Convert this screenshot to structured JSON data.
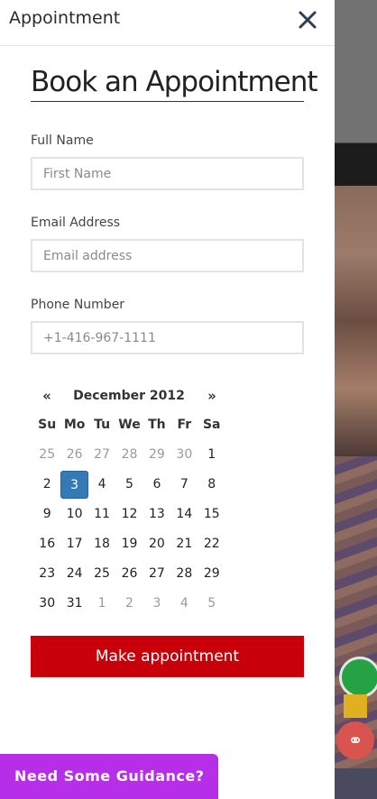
{
  "drawer": {
    "title": "Appointment",
    "close_icon": "close-icon"
  },
  "form": {
    "heading": "Book an Appointment",
    "full_name": {
      "label": "Full Name",
      "placeholder": "First Name",
      "value": ""
    },
    "email": {
      "label": "Email Address",
      "placeholder": "Email address",
      "value": ""
    },
    "phone": {
      "label": "Phone Number",
      "placeholder": "+1-416-967-1111",
      "value": ""
    },
    "submit_label": "Make appointment"
  },
  "calendar": {
    "prev_label": "«",
    "next_label": "»",
    "month_label": "December 2012",
    "weekdays": [
      "Su",
      "Mo",
      "Tu",
      "We",
      "Th",
      "Fr",
      "Sa"
    ],
    "weeks": [
      [
        {
          "d": "25",
          "muted": true
        },
        {
          "d": "26",
          "muted": true
        },
        {
          "d": "27",
          "muted": true
        },
        {
          "d": "28",
          "muted": true
        },
        {
          "d": "29",
          "muted": true
        },
        {
          "d": "30",
          "muted": true
        },
        {
          "d": "1",
          "muted": false
        }
      ],
      [
        {
          "d": "2",
          "muted": false
        },
        {
          "d": "3",
          "muted": false,
          "selected": true
        },
        {
          "d": "4",
          "muted": false
        },
        {
          "d": "5",
          "muted": false
        },
        {
          "d": "6",
          "muted": false
        },
        {
          "d": "7",
          "muted": false
        },
        {
          "d": "8",
          "muted": false
        }
      ],
      [
        {
          "d": "9",
          "muted": false
        },
        {
          "d": "10",
          "muted": false
        },
        {
          "d": "11",
          "muted": false
        },
        {
          "d": "12",
          "muted": false
        },
        {
          "d": "13",
          "muted": false
        },
        {
          "d": "14",
          "muted": false
        },
        {
          "d": "15",
          "muted": false
        }
      ],
      [
        {
          "d": "16",
          "muted": false
        },
        {
          "d": "17",
          "muted": false
        },
        {
          "d": "18",
          "muted": false
        },
        {
          "d": "19",
          "muted": false
        },
        {
          "d": "20",
          "muted": false
        },
        {
          "d": "21",
          "muted": false
        },
        {
          "d": "22",
          "muted": false
        }
      ],
      [
        {
          "d": "23",
          "muted": false
        },
        {
          "d": "24",
          "muted": false
        },
        {
          "d": "25",
          "muted": false
        },
        {
          "d": "26",
          "muted": false
        },
        {
          "d": "27",
          "muted": false
        },
        {
          "d": "28",
          "muted": false
        },
        {
          "d": "29",
          "muted": false
        }
      ],
      [
        {
          "d": "30",
          "muted": false
        },
        {
          "d": "31",
          "muted": false
        },
        {
          "d": "1",
          "muted": true
        },
        {
          "d": "2",
          "muted": true
        },
        {
          "d": "3",
          "muted": true
        },
        {
          "d": "4",
          "muted": true
        },
        {
          "d": "5",
          "muted": true
        }
      ]
    ]
  },
  "guidance_label": "Need Some Guidance?",
  "colors": {
    "submit_bg": "#c8000a",
    "selected_day": "#337ab7",
    "guidance_bg": "#b62ee8"
  },
  "background_icons": [
    "whatsapp-icon",
    "share-icon"
  ]
}
